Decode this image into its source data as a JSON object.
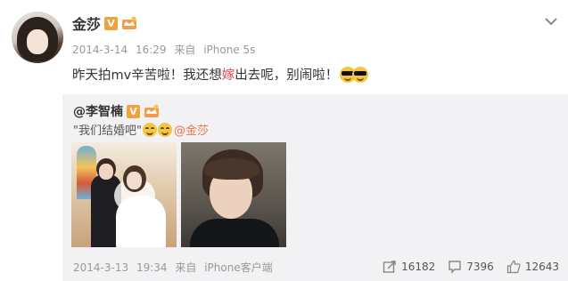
{
  "post": {
    "author": "金莎",
    "verified_badge": "V",
    "date": "2014-3-14",
    "time": "16:29",
    "from_label": "来自",
    "device": "iPhone 5s",
    "text_before": "昨天拍mv辛苦啦！我还想",
    "text_highlight": "嫁",
    "text_after": "出去呢，别闹啦！",
    "emoji": "sunglasses-emoji"
  },
  "repost": {
    "author": "@李智楠",
    "verified_badge": "V",
    "text": "\"我们结婚吧\"",
    "mention": "@金莎",
    "emoji": "grin-emoji",
    "images": [
      {
        "name": "wedding-photo"
      },
      {
        "name": "selfie-photo"
      }
    ],
    "date": "2014-3-13",
    "time": "19:34",
    "from_label": "来自",
    "device": "iPhone客户端",
    "reposts": "16182",
    "comments": "7396",
    "likes": "12643"
  },
  "colors": {
    "badge": "#f0a33c",
    "highlight": "#d84a4a",
    "mention": "#eb7350",
    "repost_bg": "#f2f2f5"
  }
}
